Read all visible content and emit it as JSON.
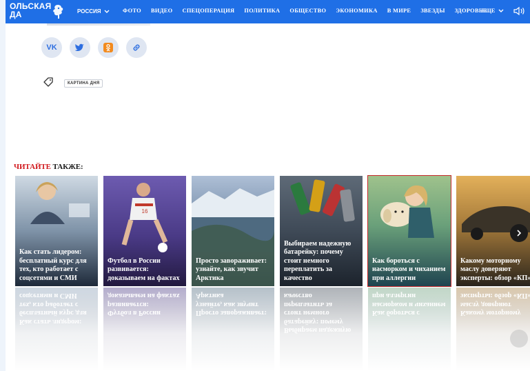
{
  "header": {
    "logo_text": "ОЛЬСКАЯ ДА",
    "region": "РОССИЯ",
    "nav": [
      "ФОТО",
      "ВИДЕО",
      "СПЕЦОПЕРАЦИЯ",
      "ПОЛИТИКА",
      "ОБЩЕСТВО",
      "ЭКОНОМИКА",
      "В МИРЕ",
      "ЗВЕЗДЫ",
      "ЗДОРОВЬЕ"
    ],
    "more": "ЕЩЕ",
    "accent_color": "#1f6fe6"
  },
  "share": {
    "icons": [
      "vk-icon",
      "twitter-icon",
      "odnoklassniki-icon",
      "link-icon"
    ]
  },
  "tags": {
    "items": [
      "КАРТИНА ДНЯ"
    ]
  },
  "also": {
    "title_red": "ЧИТАЙТЕ",
    "title_black": " ТАКЖЕ:",
    "cards": [
      {
        "text": "Как стать лидером: бесплатный курс для тех, кто работает с соцсетями и СМИ"
      },
      {
        "text": "Футбол в России развивается: доказываем на фактах"
      },
      {
        "text": "Просто завораживает: узнайте, как звучит Арктика"
      },
      {
        "text": "Выбираем надежную батарейку: почему стоит немного переплатить за качество"
      },
      {
        "text": "Как бороться с насморком и чиханием при аллергии"
      },
      {
        "text": "Какому моторному маслу доверяют эксперты: обзор «КП»"
      }
    ]
  }
}
